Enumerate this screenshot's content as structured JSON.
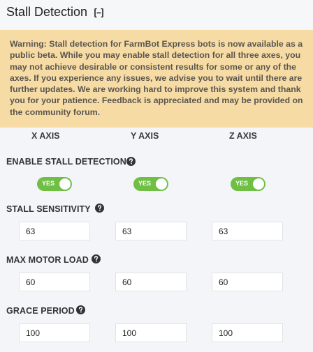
{
  "header": {
    "title": "Stall Detection",
    "collapse_icon": "collapse-icon"
  },
  "warning": {
    "text": "Warning: Stall detection for FarmBot Express bots is now available as a public beta. While you may enable stall detection for all three axes, you may not achieve desirable or consistent results for some or any of the axes. If you experience any issues, we advise you to wait until there are further updates. We are working hard to improve this system and thank you for your patience. Feedback is appreciated and may be provided on the community forum."
  },
  "axes": {
    "x": "X AXIS",
    "y": "Y AXIS",
    "z": "Z AXIS"
  },
  "enable_stall_detection": {
    "label": "ENABLE STALL DETECTION",
    "help_icon": "question-circle-icon",
    "x": "YES",
    "y": "YES",
    "z": "YES",
    "toggle_color": "#6fbf45"
  },
  "stall_sensitivity": {
    "label": "STALL SENSITIVITY",
    "help_icon": "question-circle-icon",
    "x": "63",
    "y": "63",
    "z": "63"
  },
  "max_motor_load": {
    "label": "MAX MOTOR LOAD",
    "help_icon": "question-circle-icon",
    "x": "60",
    "y": "60",
    "z": "60"
  },
  "grace_period": {
    "label": "GRACE PERIOD",
    "help_icon": "question-circle-icon",
    "x": "100",
    "y": "100",
    "z": "100"
  },
  "colors": {
    "warning_background": "#f6dca4",
    "page_background": "#f4f5f9"
  }
}
